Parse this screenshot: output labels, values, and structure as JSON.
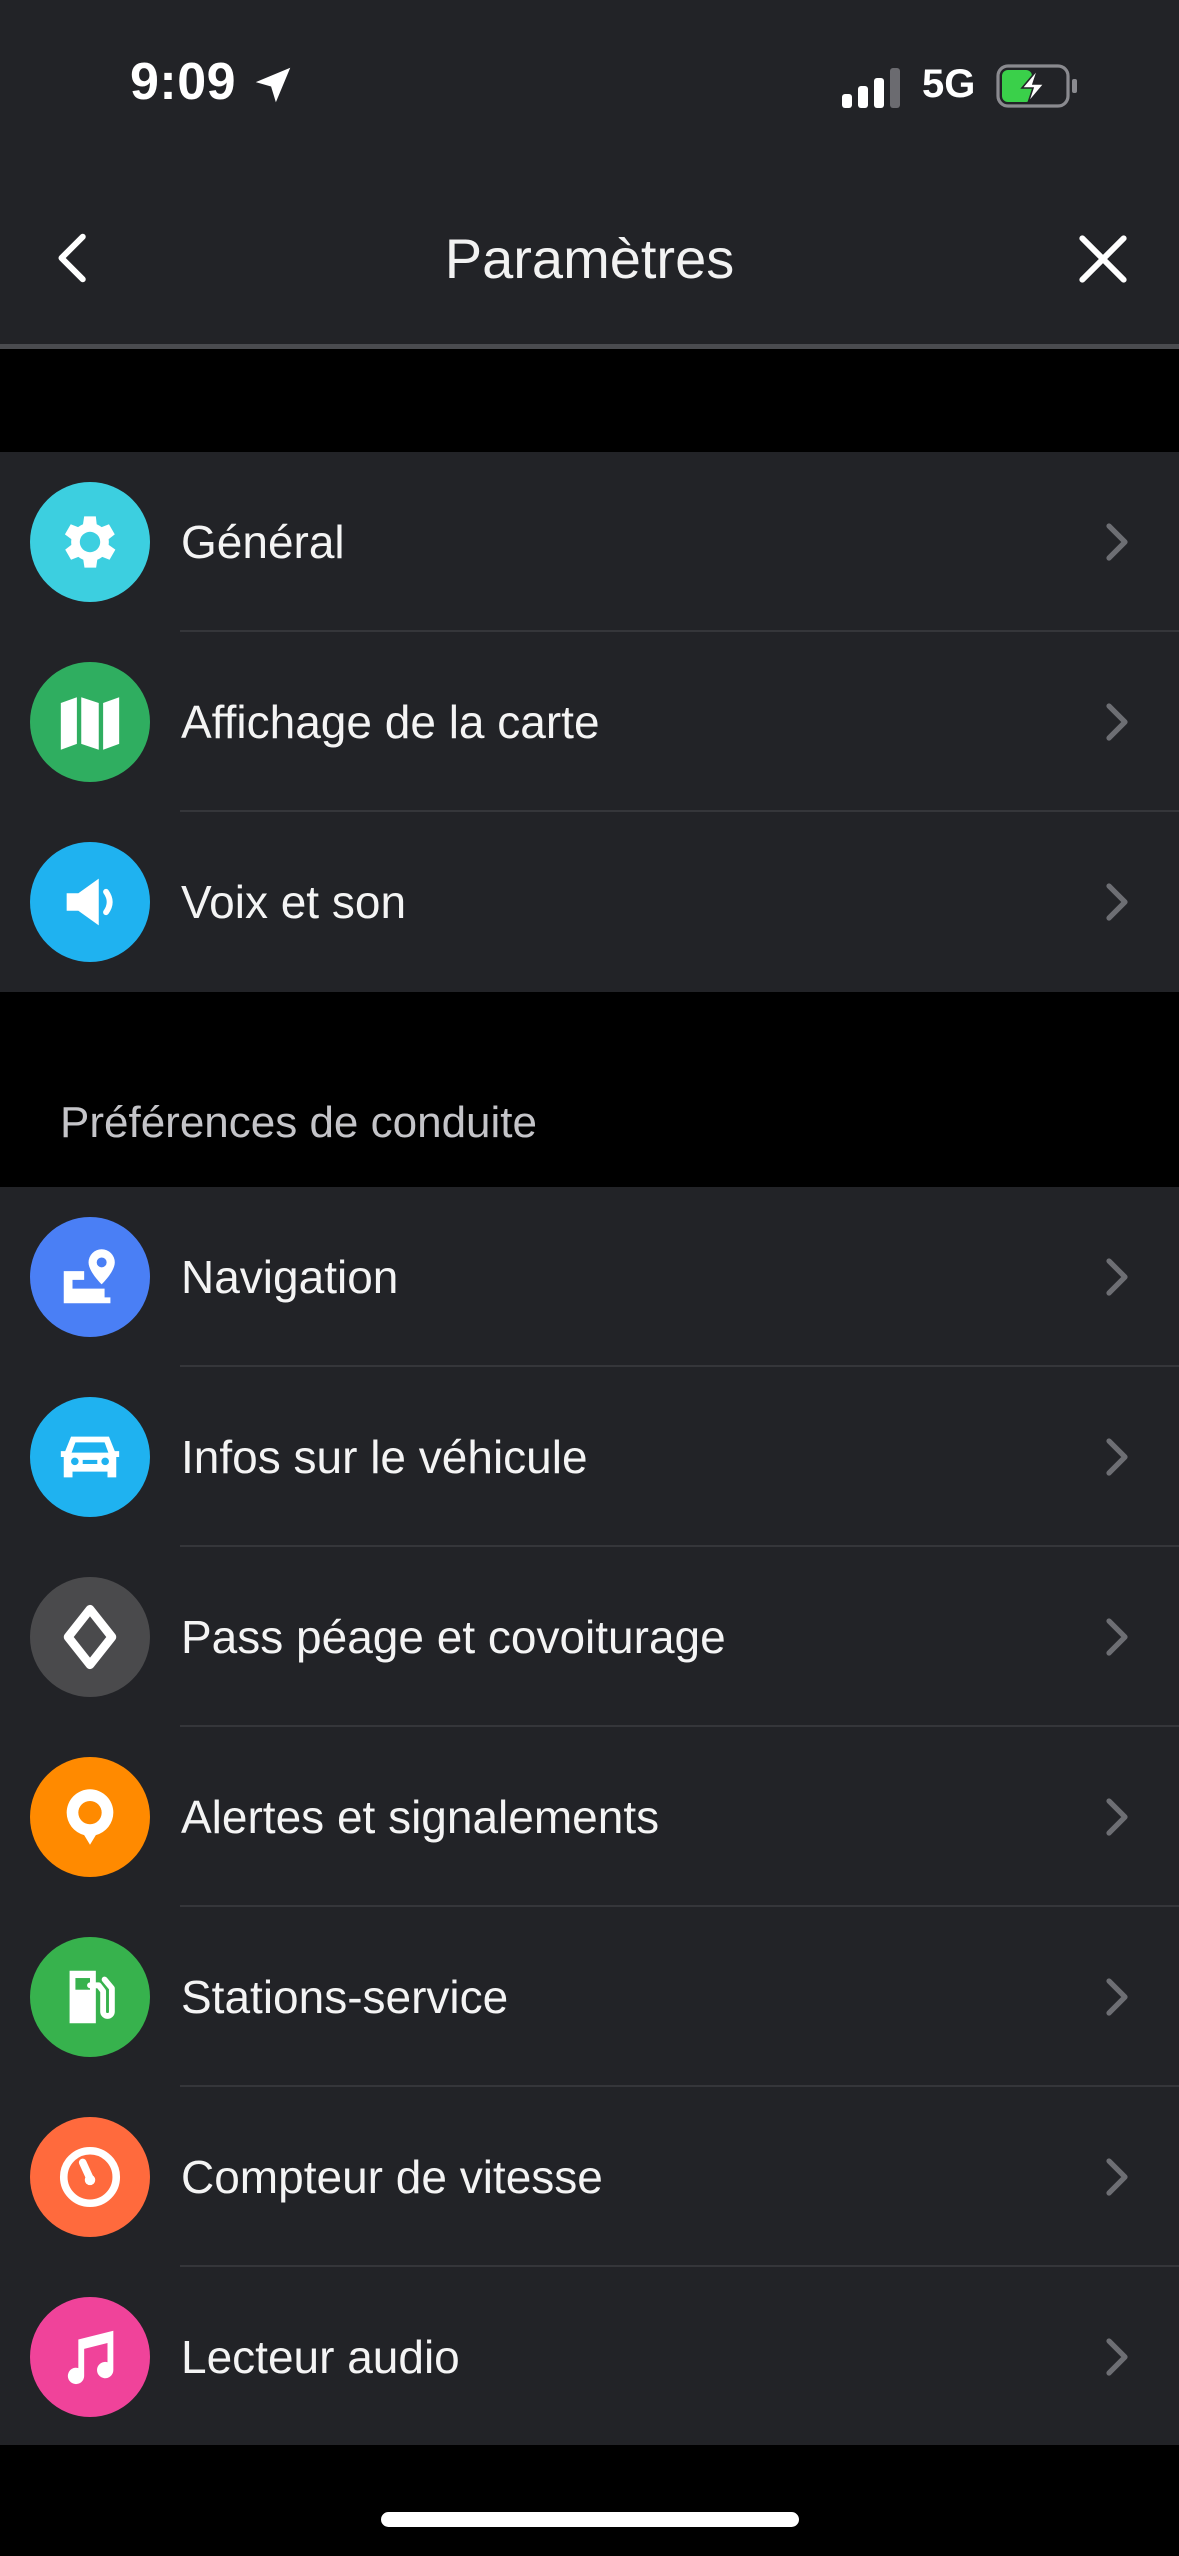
{
  "status": {
    "time": "9:09",
    "network": "5G"
  },
  "header": {
    "title": "Paramètres"
  },
  "groups": [
    {
      "items": [
        {
          "label": "Général",
          "icon": "gear-icon",
          "color": "#3ccfe0"
        },
        {
          "label": "Affichage de la carte",
          "icon": "map-icon",
          "color": "#2fae60"
        },
        {
          "label": "Voix et son",
          "icon": "speaker-icon",
          "color": "#1fb2f0"
        }
      ]
    },
    {
      "title": "Préférences de conduite",
      "items": [
        {
          "label": "Navigation",
          "icon": "navigation-map-pin-icon",
          "color": "#4a7ff5"
        },
        {
          "label": "Infos sur le véhicule",
          "icon": "car-icon",
          "color": "#1fb2f0"
        },
        {
          "label": "Pass péage et covoiturage",
          "icon": "toll-diamond-icon",
          "color": "#4a4a4c"
        },
        {
          "label": "Alertes et signalements",
          "icon": "alert-pin-icon",
          "color": "#ff8a00"
        },
        {
          "label": "Stations-service",
          "icon": "fuel-pump-icon",
          "color": "#37b24d"
        },
        {
          "label": "Compteur de vitesse",
          "icon": "speedometer-icon",
          "color": "#ff6a3d"
        },
        {
          "label": "Lecteur audio",
          "icon": "music-note-icon",
          "color": "#f0439a"
        }
      ]
    }
  ]
}
